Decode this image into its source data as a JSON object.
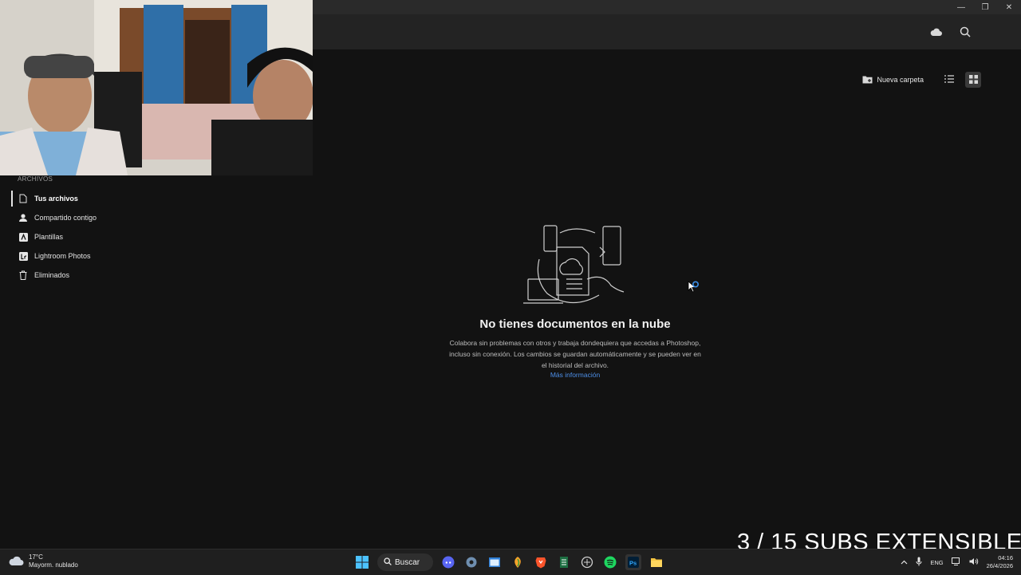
{
  "window": {
    "controls": [
      "minimize",
      "maximize",
      "close"
    ]
  },
  "header": {
    "icons": [
      "cloud-icon",
      "search-icon"
    ]
  },
  "sidebar": {
    "section_label": "ARCHIVOS",
    "items": [
      {
        "label": "Tus archivos",
        "icon": "document-icon",
        "active": true
      },
      {
        "label": "Compartido contigo",
        "icon": "person-icon",
        "active": false
      },
      {
        "label": "Plantillas",
        "icon": "templates-icon",
        "active": false
      },
      {
        "label": "Lightroom Photos",
        "icon": "lightroom-icon",
        "active": false
      },
      {
        "label": "Eliminados",
        "icon": "trash-icon",
        "active": false
      }
    ]
  },
  "toolbar": {
    "new_folder_label": "Nueva carpeta",
    "views": [
      "list-view",
      "grid-view"
    ],
    "selected_view": "grid-view"
  },
  "empty_state": {
    "title": "No tienes documentos en la nube",
    "description": "Colabora sin problemas con otros y trabaja dondequiera que accedas a Photoshop, incluso sin conexión. Los cambios se guardan automáticamente y se pueden ver en el historial del archivo.",
    "link": "Más información"
  },
  "overlay": {
    "text": "3 / 15 SUBS EXTENSIBLE"
  },
  "taskbar": {
    "weather": {
      "temp": "17°C",
      "condition": "Mayorm. nublado"
    },
    "search_label": "Buscar",
    "language": "ENG",
    "time": "04:16",
    "date": "26/4/2026"
  },
  "colors": {
    "accent_link": "#4d8fe8",
    "background": "#121212",
    "header": "#232323"
  }
}
